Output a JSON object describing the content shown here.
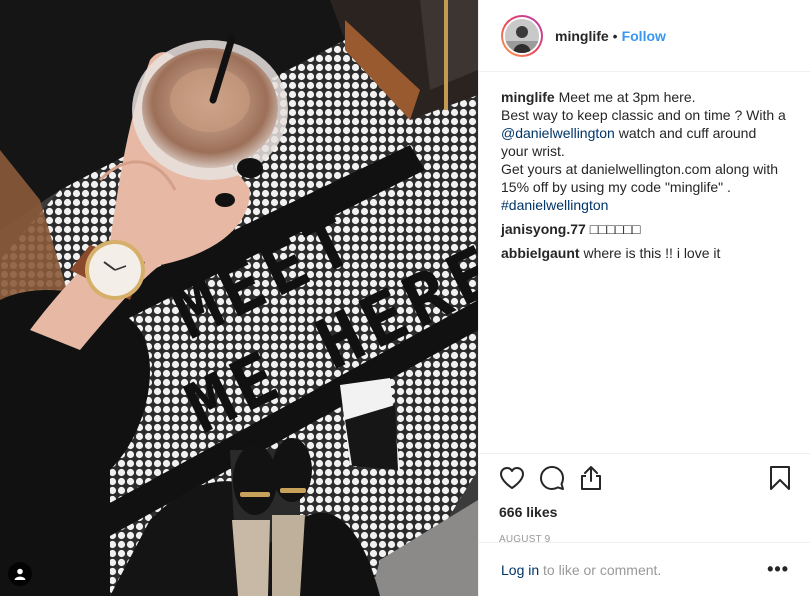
{
  "post": {
    "username": "minglife",
    "follow_label": "Follow",
    "dot": "•",
    "caption": {
      "username": "minglife",
      "line1": "Meet me at 3pm here.",
      "line2": "Best way to keep classic and on time ? With a",
      "mention": "@danielwellington",
      "line3_rest": " watch and cuff around",
      "line4": "your wrist.",
      "line5": "Get yours at danielwellington.com along with",
      "line6": "15% off by using my code \"minglife\" .",
      "hashtag": "#danielwellington"
    },
    "comments": [
      {
        "username": "janisyong.77",
        "text": "□□□□□□"
      },
      {
        "username": "abbielgaunt",
        "text": "where is this !! i love it"
      }
    ],
    "likes": "666 likes",
    "date": "AUGUST 9",
    "login_link": "Log in",
    "login_rest": " to like or comment.",
    "more_label": "•••"
  },
  "photo": {
    "sign_line1": "MEET",
    "sign_line2": "ME HERE"
  },
  "icons": {
    "like": "heart-icon",
    "comment": "comment-icon",
    "share": "share-icon",
    "save": "bookmark-icon",
    "user_tag": "user-icon"
  },
  "colors": {
    "follow": "#3897f0",
    "link": "#003569",
    "muted": "#999999",
    "text": "#262626"
  }
}
